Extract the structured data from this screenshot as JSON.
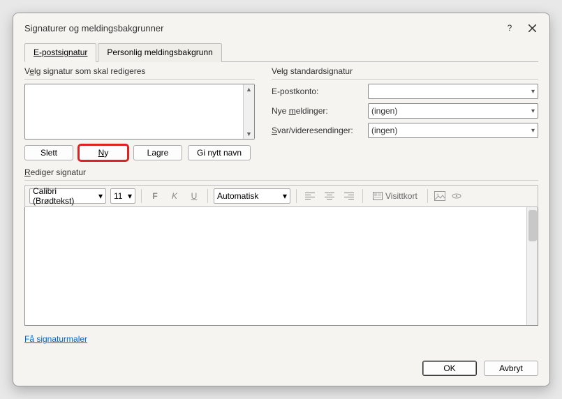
{
  "title": "Signaturer og meldingsbakgrunner",
  "tabs": {
    "email": "E-postsignatur",
    "personal": "Personlig meldingsbakgrunn"
  },
  "left": {
    "group_label_pre": "V",
    "group_label_u": "e",
    "group_label_post": "lg signatur som skal redigeres",
    "buttons": {
      "delete": "Slett",
      "new_u": "N",
      "new_post": "y",
      "save": "Lagre",
      "rename": "Gi nytt navn"
    }
  },
  "right": {
    "group_label": "Velg standardsignatur",
    "account_label": "E-postkonto:",
    "account_value": "",
    "newmsg_pre": "Nye ",
    "newmsg_u": "m",
    "newmsg_post": "eldinger:",
    "newmsg_value": "(ingen)",
    "reply_u": "S",
    "reply_post": "var/videresendinger:",
    "reply_value": "(ingen)"
  },
  "editor": {
    "header_u": "R",
    "header_post": "ediger signatur",
    "font": "Calibri (Brødtekst)",
    "size": "11",
    "bold": "F",
    "italic": "K",
    "underline": "U",
    "color": "Automatisk",
    "vcard": "Visittkort"
  },
  "link_text": "Få signaturmaler",
  "footer": {
    "ok": "OK",
    "cancel": "Avbryt"
  }
}
